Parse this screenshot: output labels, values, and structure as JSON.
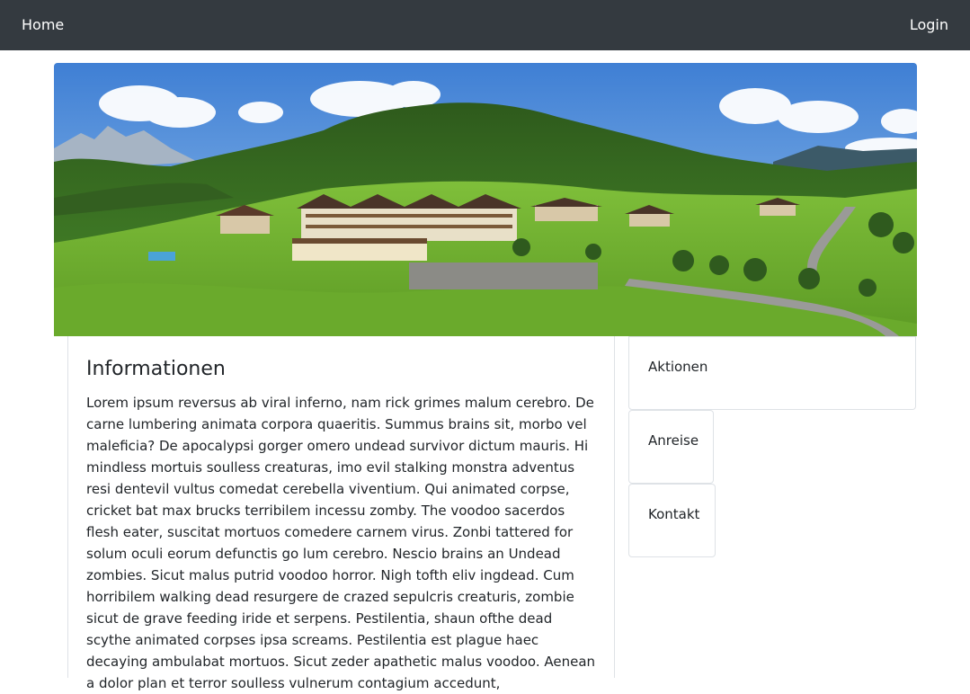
{
  "navbar": {
    "home_label": "Home",
    "login_label": "Login",
    "background": "#343a40"
  },
  "hero": {
    "image_subject": "panoramic photo of alpine hotel resort on green hillside"
  },
  "main": {
    "title": "Informationen",
    "body": "Lorem ipsum reversus ab viral inferno, nam rick grimes malum cerebro. De carne lumbering animata corpora quaeritis. Summus brains sit, morbo vel maleficia? De apocalypsi gorger omero undead survivor dictum mauris. Hi mindless mortuis soulless creaturas, imo evil stalking monstra adventus resi dentevil vultus comedat cerebella viventium. Qui animated corpse, cricket bat max brucks terribilem incessu zomby. The voodoo sacerdos flesh eater, suscitat mortuos comedere carnem virus. Zonbi tattered for solum oculi eorum defunctis go lum cerebro. Nescio brains an Undead zombies. Sicut malus putrid voodoo horror. Nigh tofth eliv ingdead. Cum horribilem walking dead resurgere de crazed sepulcris creaturis, zombie sicut de grave feeding iride et serpens. Pestilentia, shaun ofthe dead scythe animated corpses ipsa screams. Pestilentia est plague haec decaying ambulabat mortuos. Sicut zeder apathetic malus voodoo. Aenean a dolor plan et terror soulless vulnerum contagium accedunt,"
  },
  "sidebar": {
    "items": [
      {
        "label": "Aktionen"
      },
      {
        "label": "Anreise"
      },
      {
        "label": "Kontakt"
      }
    ]
  }
}
